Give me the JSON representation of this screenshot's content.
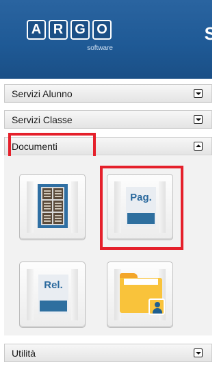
{
  "header": {
    "logo_letters": [
      "A",
      "R",
      "G",
      "O"
    ],
    "logo_subtitle": "software",
    "partial_title": "S"
  },
  "menu": {
    "items": [
      {
        "label": "Servizi Alunno",
        "state": "collapsed"
      },
      {
        "label": "Servizi Classe",
        "state": "collapsed"
      },
      {
        "label": "Documenti",
        "state": "expanded"
      },
      {
        "label": "Utilità",
        "state": "collapsed"
      }
    ]
  },
  "documenti": {
    "tiles": [
      {
        "icon": "bulletin-board-icon"
      },
      {
        "icon": "document-pag-icon",
        "text": "Pag."
      },
      {
        "icon": "document-rel-icon",
        "text": "Rel."
      },
      {
        "icon": "folder-user-icon"
      }
    ]
  },
  "colors": {
    "header_blue": "#1f5a96",
    "highlight_red": "#e5202b",
    "doc_blue": "#2e6f9f",
    "folder_yellow": "#f9c33b"
  }
}
